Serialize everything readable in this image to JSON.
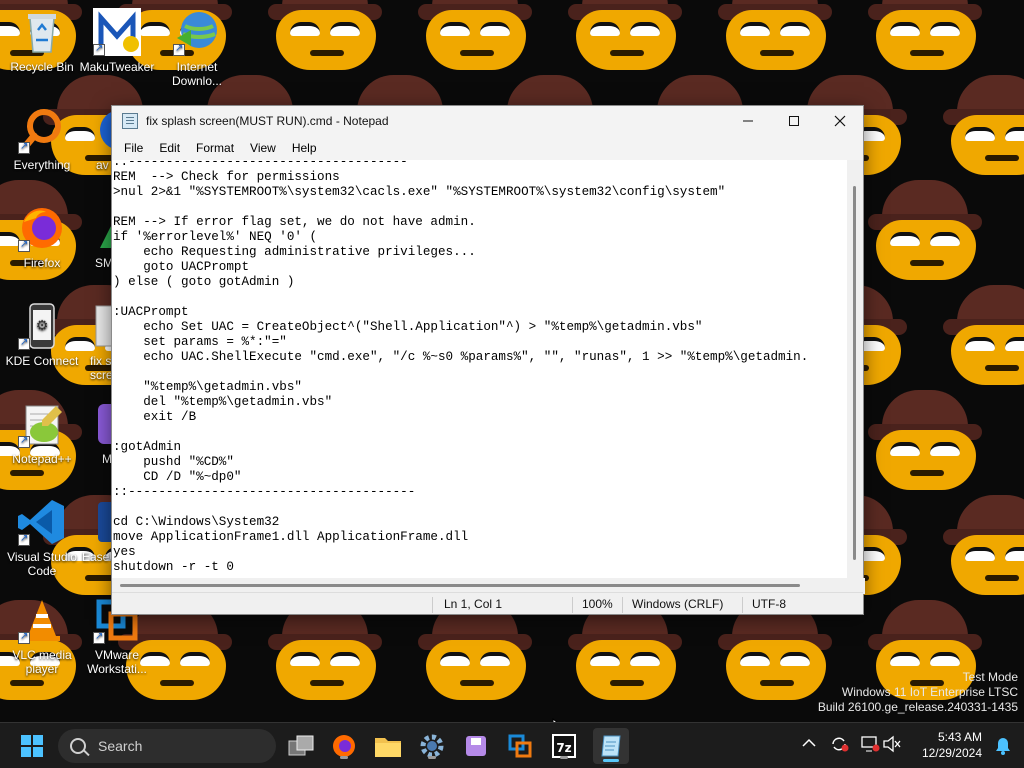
{
  "desktop": {
    "icons": [
      {
        "label": "Recycle Bin"
      },
      {
        "label": "MakuTweaker"
      },
      {
        "label": "Internet Downlo..."
      },
      {
        "label": "Everything"
      },
      {
        "label": "av Anti"
      },
      {
        "label": "Firefox"
      },
      {
        "label": "SM"
      },
      {
        "label": "KDE Connect"
      },
      {
        "label": "fix s scree"
      },
      {
        "label": "Notepad++"
      },
      {
        "label": "M"
      },
      {
        "label": "Visual Studio Code"
      },
      {
        "label": "EaseU PC"
      },
      {
        "label": "VLC media player"
      },
      {
        "label": "VMware Workstati..."
      }
    ]
  },
  "notepad": {
    "title": "fix splash screen(MUST RUN).cmd - Notepad",
    "menu": [
      "File",
      "Edit",
      "Format",
      "View",
      "Help"
    ],
    "content": "::-------------------------------------\nREM  --> Check for permissions\n>nul 2>&1 \"%SYSTEMROOT%\\system32\\cacls.exe\" \"%SYSTEMROOT%\\system32\\config\\system\"\n\nREM --> If error flag set, we do not have admin.\nif '%errorlevel%' NEQ '0' (\n    echo Requesting administrative privileges...\n    goto UACPrompt\n) else ( goto gotAdmin )\n\n:UACPrompt\n    echo Set UAC = CreateObject^(\"Shell.Application\"^) > \"%temp%\\getadmin.vbs\"\n    set params = %*:\"=\"\n    echo UAC.ShellExecute \"cmd.exe\", \"/c %~s0 %params%\", \"\", \"runas\", 1 >> \"%temp%\\getadmin.\n\n    \"%temp%\\getadmin.vbs\"\n    del \"%temp%\\getadmin.vbs\"\n    exit /B\n\n:gotAdmin\n    pushd \"%CD%\"\n    CD /D \"%~dp0\"\n::--------------------------------------\n\ncd C:\\Windows\\System32\nmove ApplicationFrame1.dll ApplicationFrame.dll\nyes\nshutdown -r -t 0",
    "status": {
      "position": "Ln 1, Col 1",
      "zoom": "100%",
      "line_ending": "Windows (CRLF)",
      "encoding": "UTF-8"
    }
  },
  "watermark": {
    "line1": "Test Mode",
    "line2": "Windows 11 IoT Enterprise LTSC",
    "line3": "Build 26100.ge_release.240331-1435"
  },
  "taskbar": {
    "search_placeholder": "Search",
    "time": "5:43 AM",
    "date": "12/29/2024"
  },
  "colors": {
    "accent": "#5ac8fa",
    "taskbar": "#1c1c1c"
  }
}
